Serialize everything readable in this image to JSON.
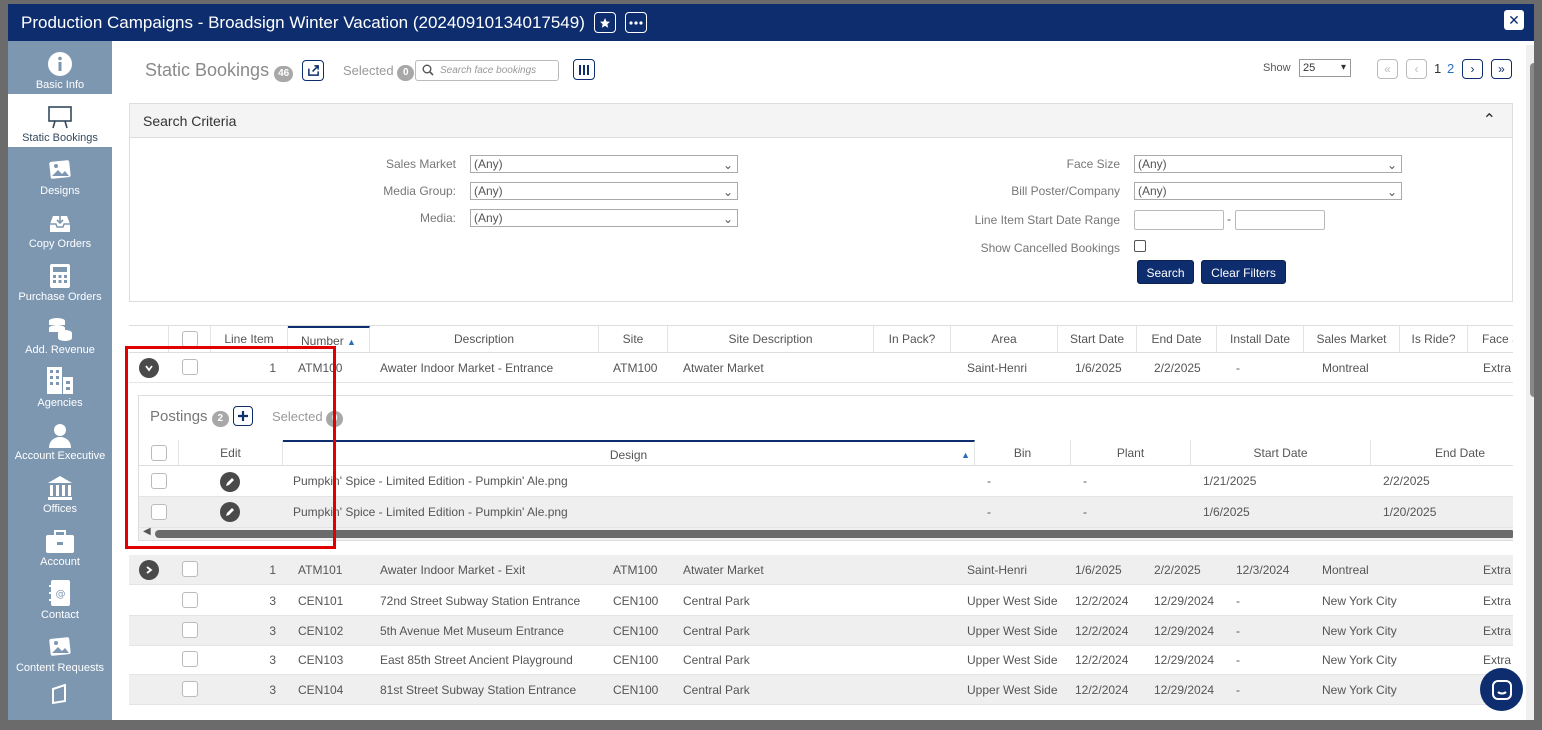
{
  "window": {
    "title": "Production Campaigns - Broadsign Winter Vacation (20240910134017549)"
  },
  "sidebar": {
    "items": [
      {
        "label": "Basic Info",
        "icon": "info-icon"
      },
      {
        "label": "Static Bookings",
        "icon": "billboard-icon",
        "active": true
      },
      {
        "label": "Designs",
        "icon": "designs-icon"
      },
      {
        "label": "Copy Orders",
        "icon": "inbox-icon"
      },
      {
        "label": "Purchase Orders",
        "icon": "calculator-icon"
      },
      {
        "label": "Add. Revenue",
        "icon": "coins-icon"
      },
      {
        "label": "Agencies",
        "icon": "building-icon"
      },
      {
        "label": "Account Executive",
        "icon": "person-icon"
      },
      {
        "label": "Offices",
        "icon": "office-icon"
      },
      {
        "label": "Account",
        "icon": "briefcase-icon"
      },
      {
        "label": "Contact",
        "icon": "contact-book-icon"
      },
      {
        "label": "Content Requests",
        "icon": "content-icon"
      }
    ]
  },
  "toolbar": {
    "title": "Static Bookings",
    "count": "46",
    "selected_label": "Selected",
    "selected_count": "0",
    "search_placeholder": "Search face bookings",
    "show_label": "Show",
    "show_value": "25",
    "pages": [
      "1",
      "2"
    ]
  },
  "criteria": {
    "title": "Search Criteria",
    "sales_market": {
      "label": "Sales Market",
      "value": "(Any)"
    },
    "media_group": {
      "label": "Media Group:",
      "value": "(Any)"
    },
    "media": {
      "label": "Media:",
      "value": "(Any)"
    },
    "face_size": {
      "label": "Face Size",
      "value": "(Any)"
    },
    "bill_poster": {
      "label": "Bill Poster/Company",
      "value": "(Any)"
    },
    "date_range": {
      "label": "Line Item Start Date Range",
      "separator": "-"
    },
    "show_cancelled": {
      "label": "Show Cancelled Bookings"
    },
    "search_label": "Search",
    "clear_label": "Clear Filters"
  },
  "grid": {
    "columns": [
      "Line Item",
      "Number",
      "Description",
      "Site",
      "Site Description",
      "In Pack?",
      "Area",
      "Start Date",
      "End Date",
      "Install Date",
      "Sales Market",
      "Is Ride?",
      "Face S"
    ],
    "rows": [
      {
        "line": "1",
        "number": "ATM100",
        "description": "Awater Indoor Market - Entrance",
        "site": "ATM100",
        "site_desc": "Atwater Market",
        "area": "Saint-Henri",
        "start": "1/6/2025",
        "end": "2/2/2025",
        "install": "-",
        "market": "Montreal",
        "face": "Extra"
      },
      {
        "line": "1",
        "number": "ATM101",
        "description": "Awater Indoor Market - Exit",
        "site": "ATM100",
        "site_desc": "Atwater Market",
        "area": "Saint-Henri",
        "start": "1/6/2025",
        "end": "2/2/2025",
        "install": "12/3/2024",
        "market": "Montreal",
        "face": "Extra"
      },
      {
        "line": "3",
        "number": "CEN101",
        "description": "72nd Street Subway Station Entrance",
        "site": "CEN100",
        "site_desc": "Central Park",
        "area": "Upper West Side",
        "start": "12/2/2024",
        "end": "12/29/2024",
        "install": "-",
        "market": "New York City",
        "face": "Extra"
      },
      {
        "line": "3",
        "number": "CEN102",
        "description": "5th Avenue Met Museum Entrance",
        "site": "CEN100",
        "site_desc": "Central Park",
        "area": "Upper West Side",
        "start": "12/2/2024",
        "end": "12/29/2024",
        "install": "-",
        "market": "New York City",
        "face": "Extra"
      },
      {
        "line": "3",
        "number": "CEN103",
        "description": "East 85th Street Ancient Playground",
        "site": "CEN100",
        "site_desc": "Central Park",
        "area": "Upper West Side",
        "start": "12/2/2024",
        "end": "12/29/2024",
        "install": "-",
        "market": "New York City",
        "face": "Extra"
      },
      {
        "line": "3",
        "number": "CEN104",
        "description": "81st Street Subway Station Entrance",
        "site": "CEN100",
        "site_desc": "Central Park",
        "area": "Upper West Side",
        "start": "12/2/2024",
        "end": "12/29/2024",
        "install": "-",
        "market": "New York City",
        "face": "E"
      }
    ]
  },
  "postings": {
    "title": "Postings",
    "count": "2",
    "selected_label": "Selected",
    "selected_count": "0",
    "columns": [
      "Edit",
      "Design",
      "Bin",
      "Plant",
      "Start Date",
      "End Date"
    ],
    "rows": [
      {
        "design": "Pumpkin' Spice - Limited Edition - Pumpkin' Ale.png",
        "bin": "-",
        "plant": "-",
        "start": "1/21/2025",
        "end": "2/2/2025"
      },
      {
        "design": "Pumpkin' Spice - Limited Edition - Pumpkin' Ale.png",
        "bin": "-",
        "plant": "-",
        "start": "1/6/2025",
        "end": "1/20/2025"
      }
    ]
  },
  "colors": {
    "brand": "#0d2d6e",
    "sidebar": "#7d97b1",
    "highlight": "#e00000"
  }
}
